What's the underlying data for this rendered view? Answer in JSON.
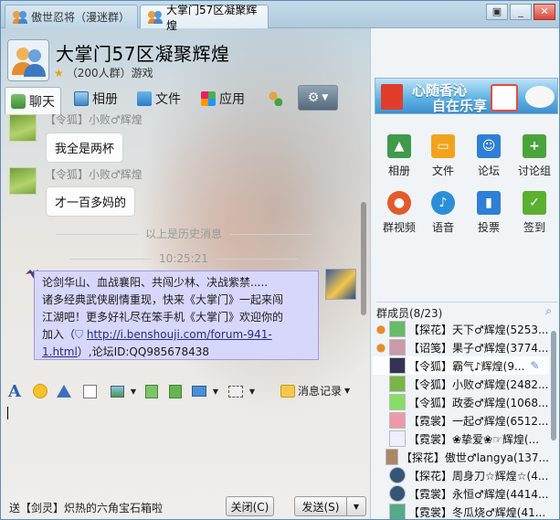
{
  "tabs": [
    {
      "label": "傲世忍将（漫迷群）"
    },
    {
      "label": "大掌门57区凝聚辉煌"
    }
  ],
  "window_buttons": {
    "menu": "▣",
    "minimize": "_",
    "close": "✕"
  },
  "header": {
    "title": "大掌门57区凝聚辉煌",
    "subtitle": "（200人群）游戏"
  },
  "toolbar": {
    "chat": "聊天",
    "album": "相册",
    "files": "文件",
    "apps": "应用"
  },
  "chat": {
    "messages": [
      {
        "sender": "【令狐】小败♂辉煌",
        "text": "我全是两杯"
      },
      {
        "sender": "【令狐】小败♂辉煌",
        "text": "才一百多妈的"
      }
    ],
    "history_divider": "以上是历史消息",
    "time": "10:25:21",
    "system_message": {
      "line1": "论剑华山、血战襄阳、共闯少林、决战紫禁.....",
      "line2": "诸多经典武侠剧情重现，快来《大掌门》一起来闯",
      "line3": "江湖吧！更多好礼尽在笨手机《大掌门》欢迎你的",
      "line4_prefix": "加入（",
      "link1": "http://i.benshouji.com/forum-941-",
      "link2": "1.html",
      "line5_suffix": "）,论坛ID:QQ985678438"
    }
  },
  "format_bar": {
    "history_label": "消息记录"
  },
  "status": {
    "text": "送【剑灵】炽热的六角宝石箱啦"
  },
  "buttons": {
    "close": "关闭(C)",
    "send": "发送(S)"
  },
  "banner": {
    "line1": "心随香沁",
    "line2": "自在乐享"
  },
  "apps": [
    {
      "label": "相册",
      "color": "#3f9a4a"
    },
    {
      "label": "文件",
      "color": "#f2a31b"
    },
    {
      "label": "论坛",
      "color": "#2f7fd6"
    },
    {
      "label": "讨论组",
      "color": "#4aa43c"
    },
    {
      "label": "群视频",
      "color": "#e35a2b"
    },
    {
      "label": "语音",
      "color": "#2a8fd8"
    },
    {
      "label": "投票",
      "color": "#2f7fd6"
    },
    {
      "label": "签到",
      "color": "#5cb030"
    }
  ],
  "members": {
    "header": "群成员(8/23)",
    "list": [
      {
        "name": "【探花】天下♂辉煌(5253..."
      },
      {
        "name": "【诏笺】果子♂辉煌(3774..."
      },
      {
        "name": "【令狐】霸气♪辉煌(9..."
      },
      {
        "name": "【令狐】小败♂辉煌(2482..."
      },
      {
        "name": "【令狐】政委♂辉煌(1068..."
      },
      {
        "name": "【霓裳】一起♂辉煌(6512..."
      },
      {
        "name": "【霓裳】❀挚爱❀☞辉煌(..."
      },
      {
        "name": "【探花】傲世♂langya(137..."
      },
      {
        "name": "【探花】周身刀☆辉煌☆(4..."
      },
      {
        "name": "【霓裳】永恒♂辉煌(4414..."
      },
      {
        "name": "【霓裳】冬瓜烧♂辉煌(41..."
      }
    ]
  }
}
